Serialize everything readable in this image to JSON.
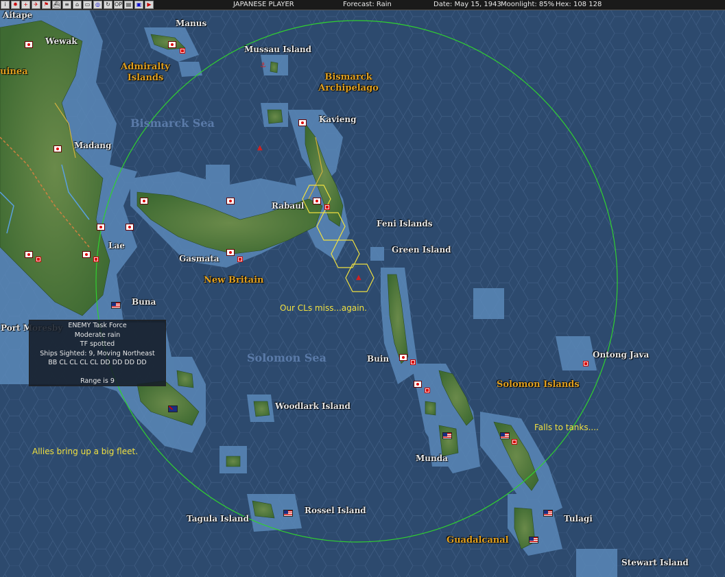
{
  "topbar": {
    "icons": [
      "info-icon",
      "jp-flag-icon",
      "plus-icon",
      "plane-icon",
      "flag-icon",
      "ship-icon",
      "list-icon",
      "stair-icon",
      "tank-icon",
      "globe-icon",
      "cycle-icon",
      "op-icon",
      "doc-icon",
      "map-icon",
      "end-turn-icon"
    ],
    "player": "JAPANESE PLAYER",
    "forecast": "Forecast: Rain",
    "date": "Date: May 15, 1943",
    "moonlight": "Moonlight: 85%",
    "hex": "Hex: 108 128"
  },
  "places": {
    "aitape": "Aitape",
    "wewak": "Wewak",
    "manus": "Manus",
    "guinea": "uinea",
    "admiralty": "Admiralty Islands",
    "mussau": "Mussau Island",
    "bismarck_arch": "Bismarck Archipelago",
    "kavieng": "Kavieng",
    "bismarck_sea": "Bismarck Sea",
    "madang": "Madang",
    "rabaul": "Rabaul",
    "feni": "Feni Islands",
    "green": "Green Island",
    "lae": "Lae",
    "gasmata": "Gasmata",
    "new_britain": "New Britain",
    "buna": "Buna",
    "port_moresby": "Port Moresby",
    "solomon_sea": "Solomon Sea",
    "buin": "Buin",
    "ontong": "Ontong Java",
    "solomon_islands": "Solomon Islands",
    "woodlark": "Woodlark Island",
    "munda": "Munda",
    "tagula": "Tagula Island",
    "rossel": "Rossel Island",
    "guadalcanal": "Guadalcanal",
    "tulagi": "Tulagi",
    "stewart": "Stewart Island"
  },
  "notes": {
    "cls_miss": "Our CLs miss...again.",
    "falls": "Falls to tanks....",
    "allies": "Allies bring up a big fleet."
  },
  "popup": {
    "title": "ENEMY Task Force",
    "weather": "Moderate rain",
    "status": "TF spotted",
    "ships": "Ships Sighted: 9, Moving Northeast",
    "composition": "BB CL CL CL CL DD DD DD DD",
    "range": "Range is 9"
  },
  "colors": {
    "ocean": "#2d4a6e",
    "shallow": "#5a88b8",
    "land": "#4a7a3a",
    "range_circle": "#30d030",
    "highlight_hex": "#f0e040",
    "label_gold": "#e0a020"
  }
}
